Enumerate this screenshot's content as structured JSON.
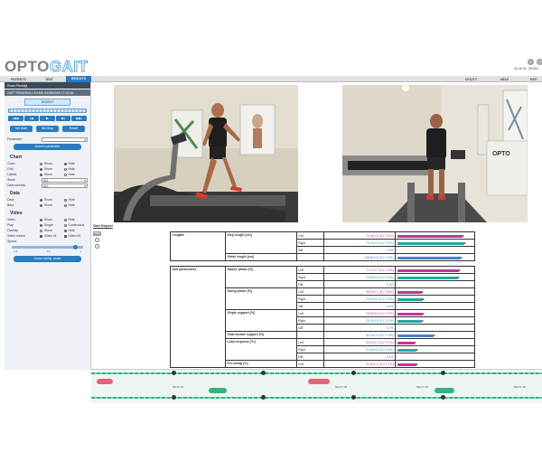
{
  "app": {
    "logo_primary": "OPTO",
    "logo_secondary": "GAIT",
    "time": "06:46:34",
    "date": "28/05/2"
  },
  "menu": {
    "left": [
      "PATIENTS",
      "TEST",
      "RESULTS"
    ],
    "right": [
      "UTILITY",
      "HELP",
      "EXIT"
    ],
    "active": "RESULTS"
  },
  "sidebar": {
    "title": "Rossi Pierluigi",
    "test_name": "GAIT TREADMILL 5 KMH 04/08/2009 17:03:36",
    "time_display": "00:28.67",
    "transport": [
      "|◀◀",
      "|◀",
      "▶",
      "▶|",
      "▶▶|"
    ],
    "set_start": "Set Start",
    "set_stop": "Set Stop",
    "reset": "Reset",
    "parameter_label": "Parameter",
    "search_params": "Search parameter",
    "chart_section": "Chart",
    "chart_rows": [
      {
        "label": "Chart",
        "opt1": "Show",
        "opt2": "Hide",
        "selected": 2
      },
      {
        "label": "Grid",
        "opt1": "Show",
        "opt2": "Hide",
        "selected": 1
      },
      {
        "label": "Labels",
        "opt1": "Show",
        "opt2": "Hide",
        "selected": 1
      }
    ],
    "show_label": "Show",
    "show_value": "ALL",
    "window_label": "Data window",
    "window_value": "ALL",
    "data_section": "Data",
    "data_rows": [
      {
        "label": "Data",
        "opt1": "Show",
        "opt2": "Hide",
        "selected": 1
      },
      {
        "label": "Bars",
        "opt1": "Show",
        "opt2": "Hide",
        "selected": 1
      }
    ],
    "video_section": "Video",
    "video_rows": [
      {
        "label": "Video",
        "opt1": "Show",
        "opt2": "Hide",
        "selected": 1
      },
      {
        "label": "Play",
        "opt1": "Single",
        "opt2": "Continuous",
        "selected": 1
      },
      {
        "label": "Overlay",
        "opt1": "Show",
        "opt2": "Hide",
        "selected": 2
      }
    ],
    "video_choice_label": "Video choice",
    "video_choice_1": "Video #1",
    "video_choice_2": "Video #2",
    "speed_label": "Speed",
    "speed_ticks": [
      "1/4",
      "1/2",
      "1"
    ],
    "close_button": "Close config. panel"
  },
  "report": {
    "title": "Gait Report",
    "zoom_label": "Zoom",
    "lengths": {
      "category": "Lengths",
      "params": [
        {
          "name": "Step length [cm]",
          "rows": [
            {
              "side": "Left",
              "value": "73.4±2.3",
              "cv": "(CV 3.1%)",
              "bar": 0.9,
              "color": "l"
            },
            {
              "side": "Right",
              "value": "75.3±2.3",
              "cv": "(CV 3.1%)",
              "bar": 0.92,
              "color": "r"
            },
            {
              "side": "Diff.",
              "value": "-2.6%",
              "cv": "",
              "bar": 0,
              "color": ""
            }
          ]
        },
        {
          "name": "Stride length [cm]",
          "rows": [
            {
              "side": "",
              "value": "148.8±2.9",
              "cv": "(CV 1.9%)",
              "bar": 0.88,
              "color": "s"
            }
          ]
        }
      ]
    },
    "gait": {
      "category": "Gait parameters",
      "params": [
        {
          "name": "Stance phase [%]",
          "rows": [
            {
              "side": "Left",
              "value": "71.7±0.7",
              "cv": "(CV 1.0%)",
              "bar": 0.85,
              "color": "l"
            },
            {
              "side": "Right",
              "value": "70.5±0.6",
              "cv": "(CV 0.8%)",
              "bar": 0.84,
              "color": "r"
            },
            {
              "side": "Diff.",
              "value": "1.6%",
              "cv": "",
              "bar": 0,
              "color": ""
            }
          ]
        },
        {
          "name": "Swing phase [%]",
          "rows": [
            {
              "side": "Left",
              "value": "28.3±0.7",
              "cv": "(CV 2.6%)",
              "bar": 0.34,
              "color": "l"
            },
            {
              "side": "Right",
              "value": "29.5±0.6",
              "cv": "(CV 2.0%)",
              "bar": 0.35,
              "color": "r"
            },
            {
              "side": "Diff.",
              "value": "-4.1%",
              "cv": "",
              "bar": 0,
              "color": ""
            }
          ]
        },
        {
          "name": "Single support [%]",
          "rows": [
            {
              "side": "Left",
              "value": "29.5±0.8",
              "cv": "(CV 2.7%)",
              "bar": 0.35,
              "color": "l"
            },
            {
              "side": "Right",
              "value": "28.4±0.9",
              "cv": "(CV 3.1%)",
              "bar": 0.34,
              "color": "r"
            },
            {
              "side": "Diff.",
              "value": "3.7%",
              "cv": "",
              "bar": 0,
              "color": ""
            }
          ]
        },
        {
          "name": "Total double support [%]",
          "rows": [
            {
              "side": "",
              "value": "42.1±1.0",
              "cv": "(CV 2.3%)",
              "bar": 0.5,
              "color": "s"
            }
          ]
        },
        {
          "name": "Load response [%]",
          "rows": [
            {
              "side": "Left",
              "value": "20.2±0.7",
              "cv": "(CV 3.7%)",
              "bar": 0.24,
              "color": "l"
            },
            {
              "side": "Right",
              "value": "21.6±0.8",
              "cv": "(CV 3.6%)",
              "bar": 0.26,
              "color": "r"
            },
            {
              "side": "Diff.",
              "value": "-6.1%",
              "cv": "",
              "bar": 0,
              "color": ""
            }
          ]
        },
        {
          "name": "Pre-swing [%]",
          "rows": [
            {
              "side": "Left",
              "value": "22.0±1.0",
              "cv": "(CV 4.7%)",
              "bar": 0.26,
              "color": "l"
            }
          ]
        }
      ]
    }
  },
  "strip": {
    "step_labels": [
      "Ste N. 17",
      "Ste N. 18",
      "Ste N. 19",
      "Ste N. 20"
    ]
  },
  "colors": {
    "accent": "#2c7bbf",
    "left": "#c0379a",
    "right": "#1fa8a2",
    "stride": "#4a7fd1"
  }
}
